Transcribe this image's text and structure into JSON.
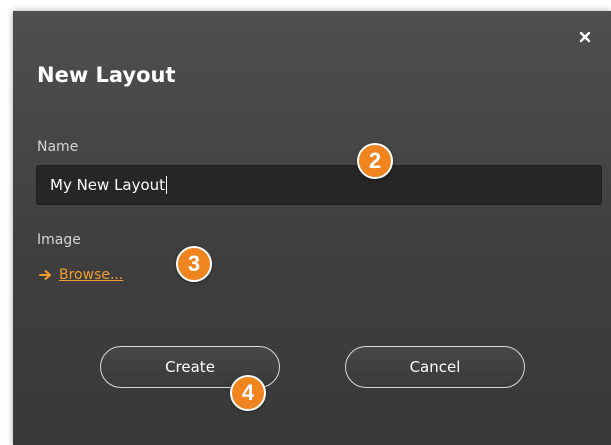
{
  "dialog": {
    "title": "New Layout",
    "close_icon": "close-icon",
    "name_label": "Name",
    "name_value": "My New Layout",
    "image_label": "Image",
    "browse_icon": "arrow-right-icon",
    "browse_label": "Browse...",
    "create_label": "Create",
    "cancel_label": "Cancel"
  },
  "callouts": {
    "step_2": "2",
    "step_3": "3",
    "step_4": "4"
  },
  "colors": {
    "dialog_background": "#444444",
    "accent": "#f39c2d",
    "callout_badge": "#f0841f",
    "input_background": "#262626"
  }
}
